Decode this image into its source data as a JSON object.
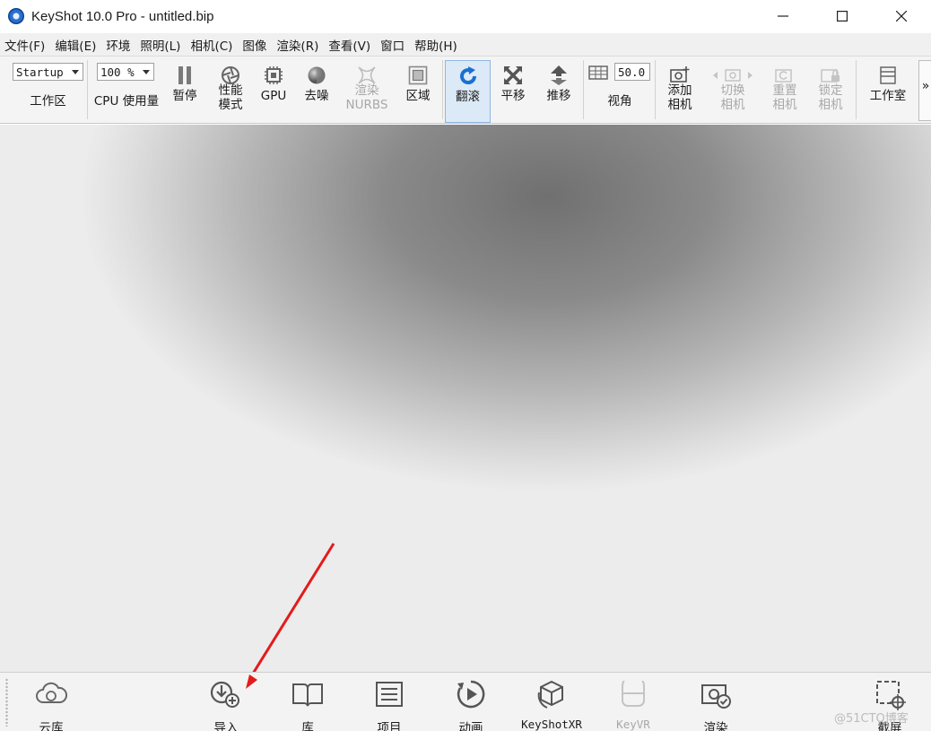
{
  "window": {
    "title": "KeyShot 10.0 Pro  - untitled.bip",
    "controls": [
      "minimize",
      "maximize",
      "close"
    ]
  },
  "menu": [
    "文件(F)",
    "编辑(E)",
    "环境",
    "照明(L)",
    "相机(C)",
    "图像",
    "渲染(R)",
    "查看(V)",
    "窗口",
    "帮助(H)"
  ],
  "toolbar": {
    "workspace_value": "Startup",
    "workspace_label": "工作区",
    "cpu_value": "100 %",
    "cpu_label": "CPU 使用量",
    "pause": "暂停",
    "performance_mode": "性能\n模式",
    "gpu": "GPU",
    "denoise": "去噪",
    "render_nurbs": "渲染\nNURBS",
    "region": "区域",
    "tumble": "翻滚",
    "pan": "平移",
    "dolly": "推移",
    "fov_value": "50.0",
    "fov_label": "视角",
    "add_camera": "添加\n相机",
    "switch_camera": "切换\n相机",
    "reset_camera": "重置\n相机",
    "lock_camera": "锁定\n相机",
    "studio": "工作室",
    "more": "»"
  },
  "bottom": {
    "cloud_library": "云库",
    "import": "导入",
    "library": "库",
    "project": "项目",
    "animation": "动画",
    "keyshotxr": "KeyShotXR",
    "keyvr": "KeyVR",
    "render": "渲染",
    "screenshot": "截屏"
  },
  "watermark": "@51CTO博客",
  "colors": {
    "annotation_arrow": "#e31b1b",
    "active_tool_bg": "#dce9f7",
    "icon_blue": "#1c6fd1"
  }
}
